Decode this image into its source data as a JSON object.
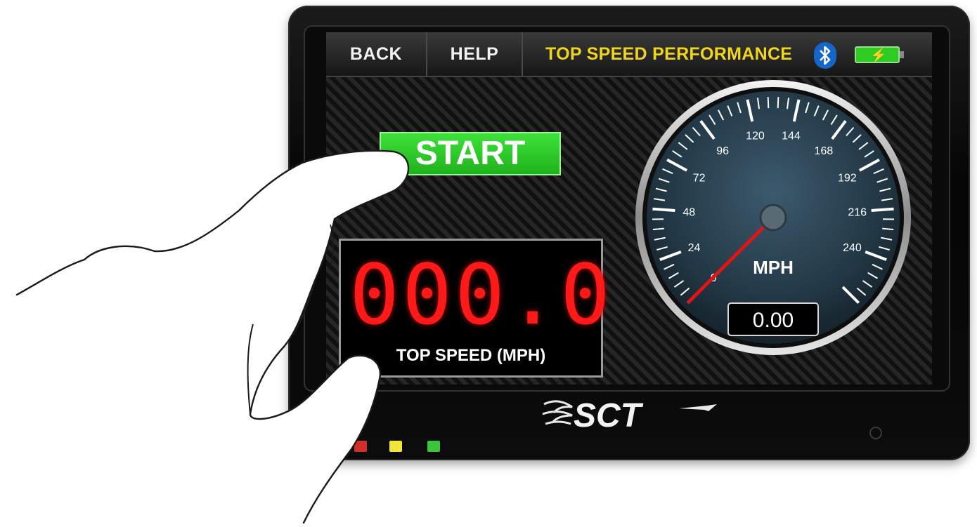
{
  "topbar": {
    "back_label": "BACK",
    "help_label": "HELP",
    "title": "TOP SPEED PERFORMANCE",
    "bluetooth_icon": "bluetooth-icon",
    "battery_icon": "battery-charging-icon"
  },
  "start_button": {
    "label": "START"
  },
  "speed_display": {
    "value": "000.0",
    "label": "TOP SPEED (MPH)"
  },
  "gauge": {
    "unit": "MPH",
    "readout": "0.00",
    "min": 0,
    "max": 264,
    "needle_value": 0,
    "tick_labels": [
      "0",
      "24",
      "48",
      "72",
      "96",
      "120",
      "144",
      "168",
      "192",
      "216",
      "240"
    ]
  },
  "brand": {
    "logo": "SCT"
  },
  "status_leds": [
    "red",
    "yellow",
    "green"
  ],
  "colors": {
    "title_yellow": "#f1d51c",
    "start_green": "#2ecc23",
    "led_red": "#ff1a1a",
    "bluetooth_blue": "#1566c9"
  }
}
